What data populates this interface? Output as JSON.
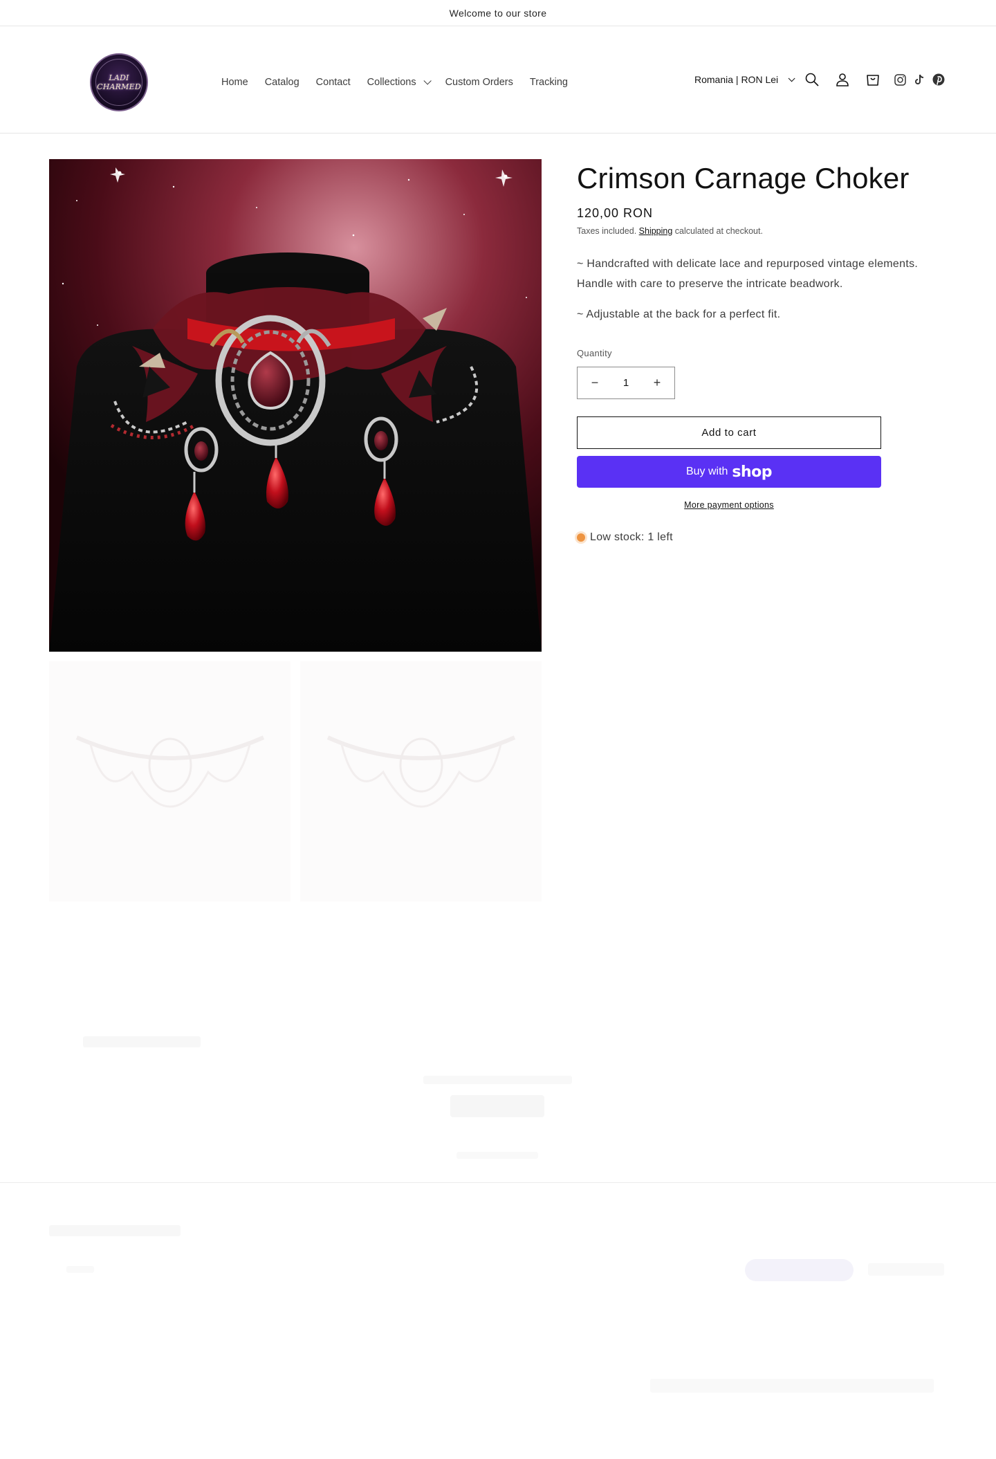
{
  "announcement": {
    "text": "Welcome to our store"
  },
  "header": {
    "logo_text": "LADI CHARMED",
    "nav": [
      {
        "label": "Home",
        "dropdown": false
      },
      {
        "label": "Catalog",
        "dropdown": false
      },
      {
        "label": "Contact",
        "dropdown": false
      },
      {
        "label": "Collections",
        "dropdown": true
      },
      {
        "label": "Custom Orders",
        "dropdown": false
      },
      {
        "label": "Tracking",
        "dropdown": false
      }
    ],
    "country_selector": "Romania | RON Lei",
    "icons": [
      "search-icon",
      "account-icon",
      "cart-icon",
      "instagram-icon",
      "tiktok-icon",
      "pinterest-icon"
    ]
  },
  "product": {
    "title": "Crimson Carnage Choker",
    "price": "120,00 RON",
    "tax_prefix": "Taxes included.",
    "tax_link": "Shipping",
    "tax_suffix": "calculated at checkout.",
    "description": [
      "~ Handcrafted with delicate lace and repurposed vintage elements. Handle with care to preserve the intricate beadwork.",
      "~ Adjustable at the back for a perfect fit."
    ],
    "quantity_label": "Quantity",
    "quantity_value": "1",
    "add_to_cart": "Add to cart",
    "buy_with": "Buy with",
    "buy_brand": "shop",
    "more_payment": "More payment options",
    "stock_text": "Low stock: 1 left"
  },
  "colors": {
    "accent_shop": "#5a31f4",
    "stock_dot": "#ee9441",
    "text": "#121212"
  }
}
